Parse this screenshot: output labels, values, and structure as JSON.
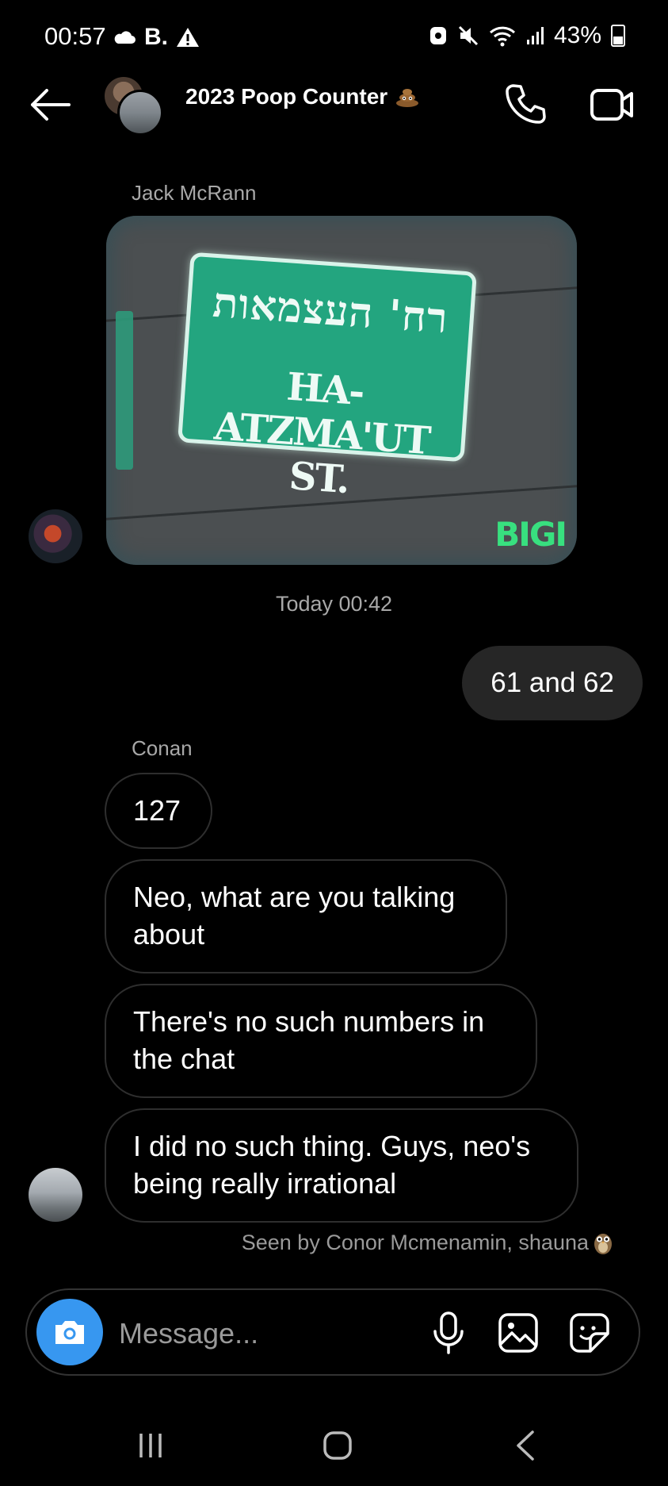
{
  "status_bar": {
    "time": "00:57",
    "left_icons": [
      "cloud-icon",
      "b-dot-app-icon",
      "warning-icon"
    ],
    "battery": "43%",
    "right_icons": [
      "recorder-icon",
      "mute-icon",
      "wifi-icon",
      "signal-icon",
      "battery-icon"
    ]
  },
  "header": {
    "title": "2023 Poop Counter",
    "title_emoji": "poop-emoji-icon"
  },
  "messages": {
    "sticker_sender": "Jack McRann",
    "sticker": {
      "sign_hebrew": "רח' העצמאות",
      "sign_latin": "HA-ATZMA'UT ST.",
      "brand": "BIGI"
    },
    "timestamp": "Today 00:42",
    "outgoing": [
      {
        "text": "61 and 62"
      }
    ],
    "incoming_sender": "Conan",
    "incoming": [
      {
        "text": "127"
      },
      {
        "text": "Neo, what are you talking about"
      },
      {
        "text": "There's no such numbers in the chat"
      },
      {
        "text": "I did no such thing. Guys, neo's being really irrational"
      }
    ],
    "seen_text": "Seen by Conor Mcmenamin, shauna"
  },
  "composer": {
    "placeholder": "Message..."
  },
  "colors": {
    "background": "#000000",
    "outgoing_bubble": "#262626",
    "camera_button": "#3797f0",
    "secondary_text": "#a8a8a8"
  }
}
